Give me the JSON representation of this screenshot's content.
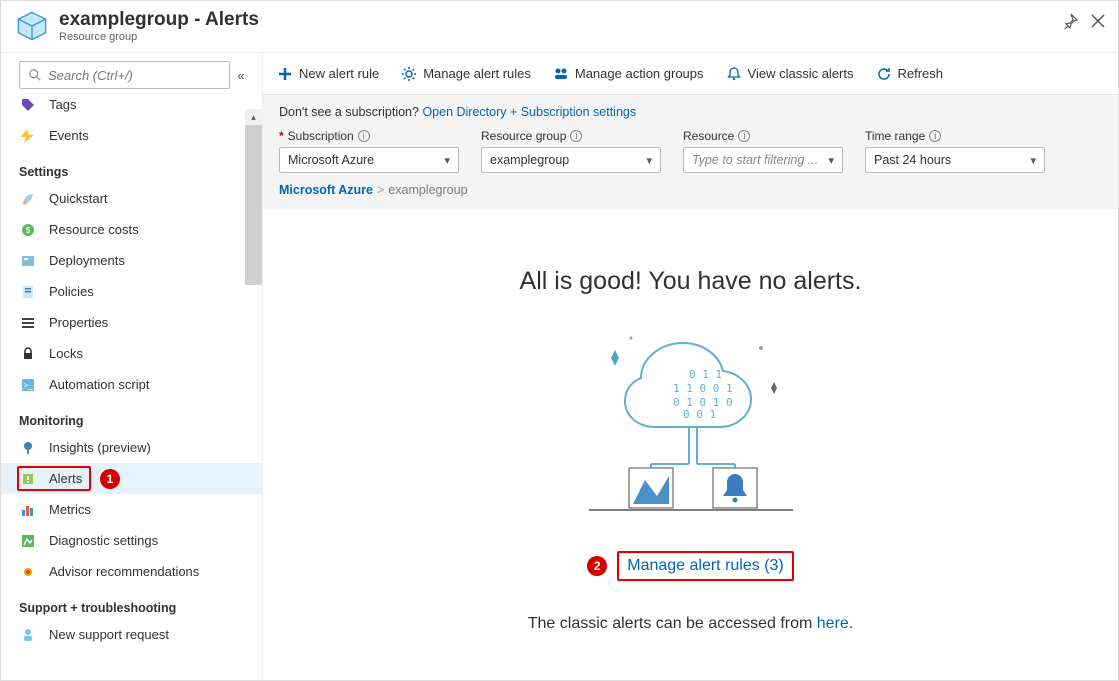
{
  "header": {
    "title": "examplegroup - Alerts",
    "subtitle": "Resource group"
  },
  "search": {
    "placeholder": "Search (Ctrl+/)"
  },
  "sidebar": {
    "items": [
      {
        "label": "Tags"
      },
      {
        "label": "Events"
      }
    ],
    "groups": [
      {
        "title": "Settings",
        "items": [
          {
            "label": "Quickstart"
          },
          {
            "label": "Resource costs"
          },
          {
            "label": "Deployments"
          },
          {
            "label": "Policies"
          },
          {
            "label": "Properties"
          },
          {
            "label": "Locks"
          },
          {
            "label": "Automation script"
          }
        ]
      },
      {
        "title": "Monitoring",
        "items": [
          {
            "label": "Insights (preview)"
          },
          {
            "label": "Alerts"
          },
          {
            "label": "Metrics"
          },
          {
            "label": "Diagnostic settings"
          },
          {
            "label": "Advisor recommendations"
          }
        ]
      },
      {
        "title": "Support + troubleshooting",
        "items": [
          {
            "label": "New support request"
          }
        ]
      }
    ]
  },
  "toolbar": {
    "new_alert": "New alert rule",
    "manage_rules": "Manage alert rules",
    "manage_groups": "Manage action groups",
    "view_classic": "View classic alerts",
    "refresh": "Refresh"
  },
  "filters": {
    "note_prefix": "Don't see a subscription? ",
    "note_link": "Open Directory + Subscription settings",
    "subscription_label": "Subscription",
    "subscription_value": "Microsoft Azure",
    "rg_label": "Resource group",
    "rg_value": "examplegroup",
    "resource_label": "Resource",
    "resource_placeholder": "Type to start filtering ...",
    "time_label": "Time range",
    "time_value": "Past 24 hours"
  },
  "breadcrumb": {
    "root": "Microsoft Azure",
    "current": "examplegroup"
  },
  "empty": {
    "title": "All is good! You have no alerts.",
    "manage_link": "Manage alert rules (3)",
    "classic_prefix": "The classic alerts can be accessed from ",
    "classic_link": "here",
    "classic_suffix": "."
  },
  "callouts": {
    "one": "1",
    "two": "2"
  }
}
